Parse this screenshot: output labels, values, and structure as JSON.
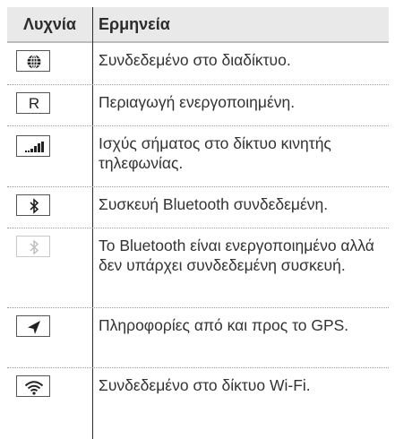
{
  "header": {
    "col_icon": "Λυχνία",
    "col_meaning": "Ερμηνεία"
  },
  "rows": [
    {
      "icon": "globe-icon",
      "text": "Συνδεδεμένο στο διαδίκτυο."
    },
    {
      "icon": "roaming-r-icon",
      "icon_text": "R",
      "text": "Περιαγωγή ενεργοποιημένη."
    },
    {
      "icon": "signal-strength-icon",
      "text": "Ισχύς σήματος στο δίκτυο κινητής τηλεφωνίας."
    },
    {
      "icon": "bluetooth-icon",
      "text": "Συσκευή Bluetooth συνδεδεμένη."
    },
    {
      "icon": "bluetooth-faded-icon",
      "text": "Το Bluetooth είναι ενεργοποιημένο αλλά δεν υπάρχει συνδεδεμένη συσκευή."
    },
    {
      "icon": "gps-arrow-icon",
      "text": "Πληροφορίες από και προς το GPS."
    },
    {
      "icon": "wifi-icon",
      "text": "Συνδεδεμένο στο δίκτυο Wi-Fi."
    }
  ]
}
